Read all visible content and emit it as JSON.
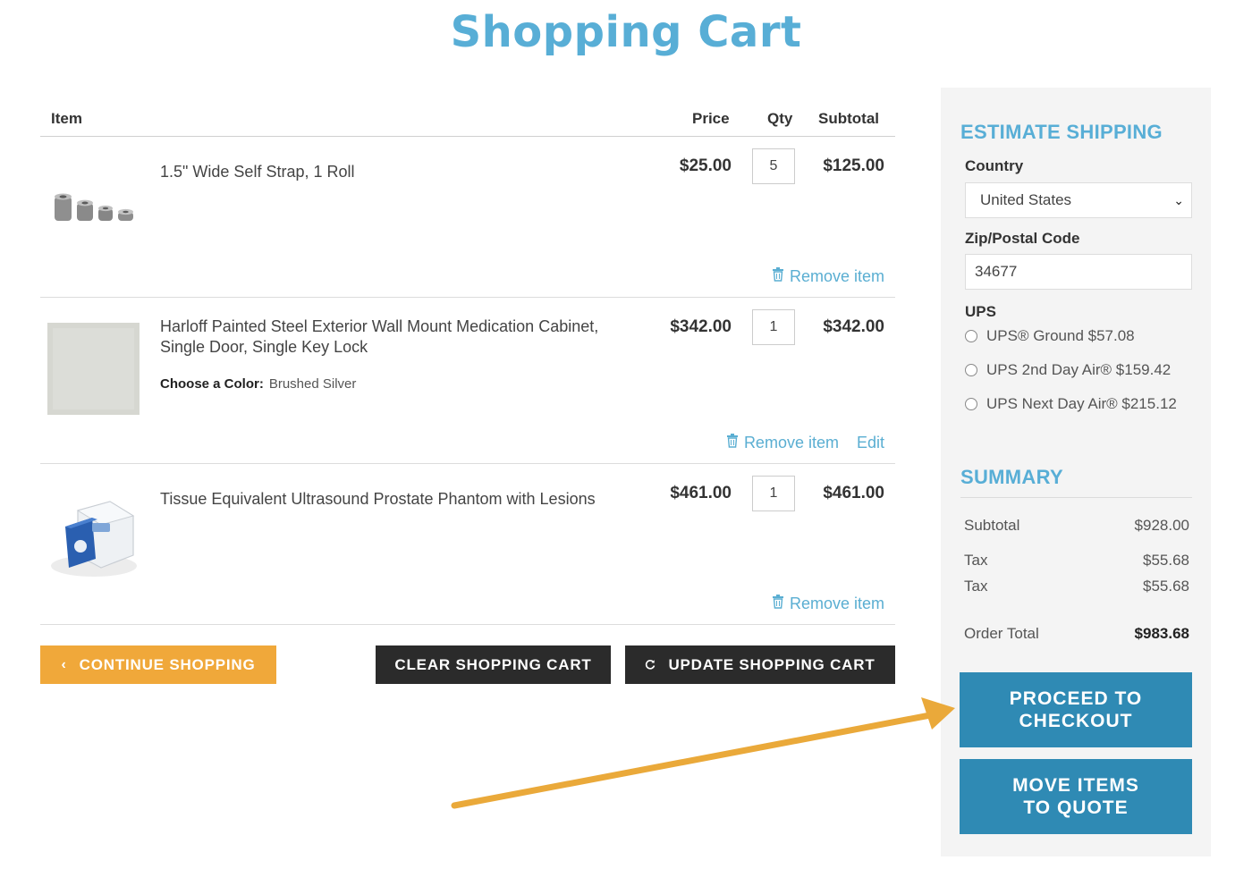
{
  "page": {
    "title": "Shopping Cart"
  },
  "table": {
    "headers": {
      "item": "Item",
      "price": "Price",
      "qty": "Qty",
      "subtotal": "Subtotal"
    }
  },
  "items": [
    {
      "name": "1.5\" Wide Self Strap, 1 Roll",
      "price": "$25.00",
      "qty": "5",
      "subtotal": "$125.00",
      "remove_label": "Remove item"
    },
    {
      "name": "Harloff Painted Steel Exterior Wall Mount Medication Cabinet, Single Door, Single Key Lock",
      "option_label": "Choose a Color:",
      "option_value": "Brushed Silver",
      "price": "$342.00",
      "qty": "1",
      "subtotal": "$342.00",
      "remove_label": "Remove item",
      "edit_label": "Edit"
    },
    {
      "name": "Tissue Equivalent Ultrasound Prostate Phantom with Lesions",
      "price": "$461.00",
      "qty": "1",
      "subtotal": "$461.00",
      "remove_label": "Remove item"
    }
  ],
  "buttons": {
    "continue": "CONTINUE SHOPPING",
    "clear": "CLEAR SHOPPING CART",
    "update": "UPDATE SHOPPING CART"
  },
  "shipping": {
    "heading": "ESTIMATE SHIPPING",
    "country_label": "Country",
    "country_value": "United States",
    "zip_label": "Zip/Postal Code",
    "zip_value": "34677",
    "carrier": "UPS",
    "options": [
      "UPS® Ground $57.08",
      "UPS 2nd Day Air® $159.42",
      "UPS Next Day Air® $215.12"
    ]
  },
  "summary": {
    "heading": "SUMMARY",
    "rows": [
      {
        "label": "Subtotal",
        "value": "$928.00"
      },
      {
        "label": "Tax",
        "value": "$55.68"
      },
      {
        "label": "Tax",
        "value": "$55.68"
      }
    ],
    "total_label": "Order Total",
    "total_value": "$983.68"
  },
  "cta": {
    "checkout": "PROCEED TO CHECKOUT",
    "quote": "MOVE ITEMS TO QUOTE"
  },
  "colors": {
    "accent": "#58aed6",
    "cta": "#2f8ab4",
    "continue": "#f0a83a",
    "dark_button": "#2b2b2b",
    "annotation_arrow": "#eaa93a"
  }
}
